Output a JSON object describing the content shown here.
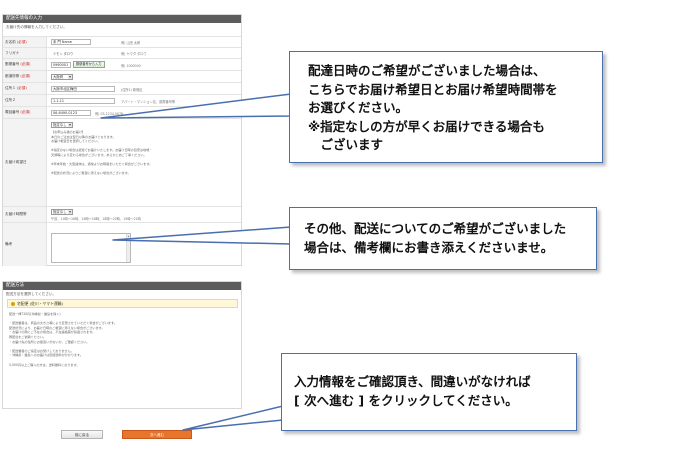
{
  "delivery_info": {
    "title": "配送先情報の入力",
    "note": "お届け先の情報を入力してください。",
    "fields": [
      {
        "label": "お名前",
        "required": "(必須)",
        "value": "未 門 Name",
        "hint": "例) 山田 太郎"
      },
      {
        "label": "フリガナ",
        "required": "",
        "value": "ミモン タロウ",
        "hint": "例) ヤマダ タロウ"
      },
      {
        "label": "郵便番号",
        "required": "(必須)",
        "value": "0960001",
        "button": "郵便番号から入力",
        "hint": "例) 1000000"
      },
      {
        "label": "都道府県",
        "required": "(必須)",
        "value": "大阪府",
        "hint": ""
      },
      {
        "label": "住所１",
        "required": "(必須)",
        "value": "大阪市北区梅田",
        "hint": "(住所1) 新宿区"
      },
      {
        "label": "住所２",
        "required": "",
        "value": "1-1-11",
        "hint": "アパート・マンション名、部屋番号等"
      },
      {
        "label": "電話番号",
        "required": "(必須)",
        "value": "06-6490-0123",
        "hint": "例) 03-1234-5678"
      }
    ],
    "delivery_wish": {
      "label": "お届け希望日",
      "selected": "指定なし",
      "text": "【お申込み後のお届け】\n本日のご注文は翌日以降のお届けとなります。\nお届け希望日を選択してください。\n\n※指定のない場合は最短でお届けいたします。お届け日時の目安は地域・\n天候等により変わる場合がございます。あらかじめご了承ください。\n\n※年末年始・大型連休は、通常よりお時間をいただく場合がございます。\n\n※配送の状況によりご希望に添えない場合がございます。"
    },
    "delivery_time": {
      "label": "お届け時間帯",
      "selected": "指定なし",
      "hint": "午前、14時〜16時、16時〜18時、18時〜20時、19時〜21時"
    },
    "remarks": {
      "label": "備考"
    }
  },
  "shipping_method": {
    "title": "配送方法",
    "note": "配送方法を選択してください。",
    "option": "宅配便 (佐川・ヤマト運輸)",
    "text": "配送一律720円(沖縄県・離島を除く)\n\n・配送業者は、商品の大きさ等により変更させていただく場合がございます。\n 配送状況により、お届け日時のご希望に添えない場合がございます。\n・お届けの際にご不在の場合は、不在連絡票が投函されます。\n 再配達をご依頼ください。\n・お届け先の住所にお間違いがないか、ご確認ください。\n\n・配送業者のご指定はお受けしておりません。\n・沖縄県・離島へのお届けは別途送料がかかります。\n\n5,000円以上ご購入の方は、送料無料となります。"
  },
  "buttons": {
    "back": "前に戻る",
    "next": "次へ進む"
  },
  "callouts": {
    "date_time": "配達日時のご希望がございました場合は、\nこちらでお届け希望日とお届け希望時間帯を\nお選びください。\n※指定なしの方が早くお届けできる場合も\n　ございます",
    "remarks": "その他、配送についてのご希望がございました\n場合は、備考欄にお書き添えくださいませ。",
    "confirm": "入力情報をご確認頂き、間違いがなければ\n[ 次へ進む ] をクリックしてください。"
  },
  "colors": {
    "header_bg": "#5c5c5c",
    "next_button": "#e8752c",
    "callout_border": "#4a6fae",
    "option_bg": "#fff7d8",
    "required": "#d02020"
  }
}
